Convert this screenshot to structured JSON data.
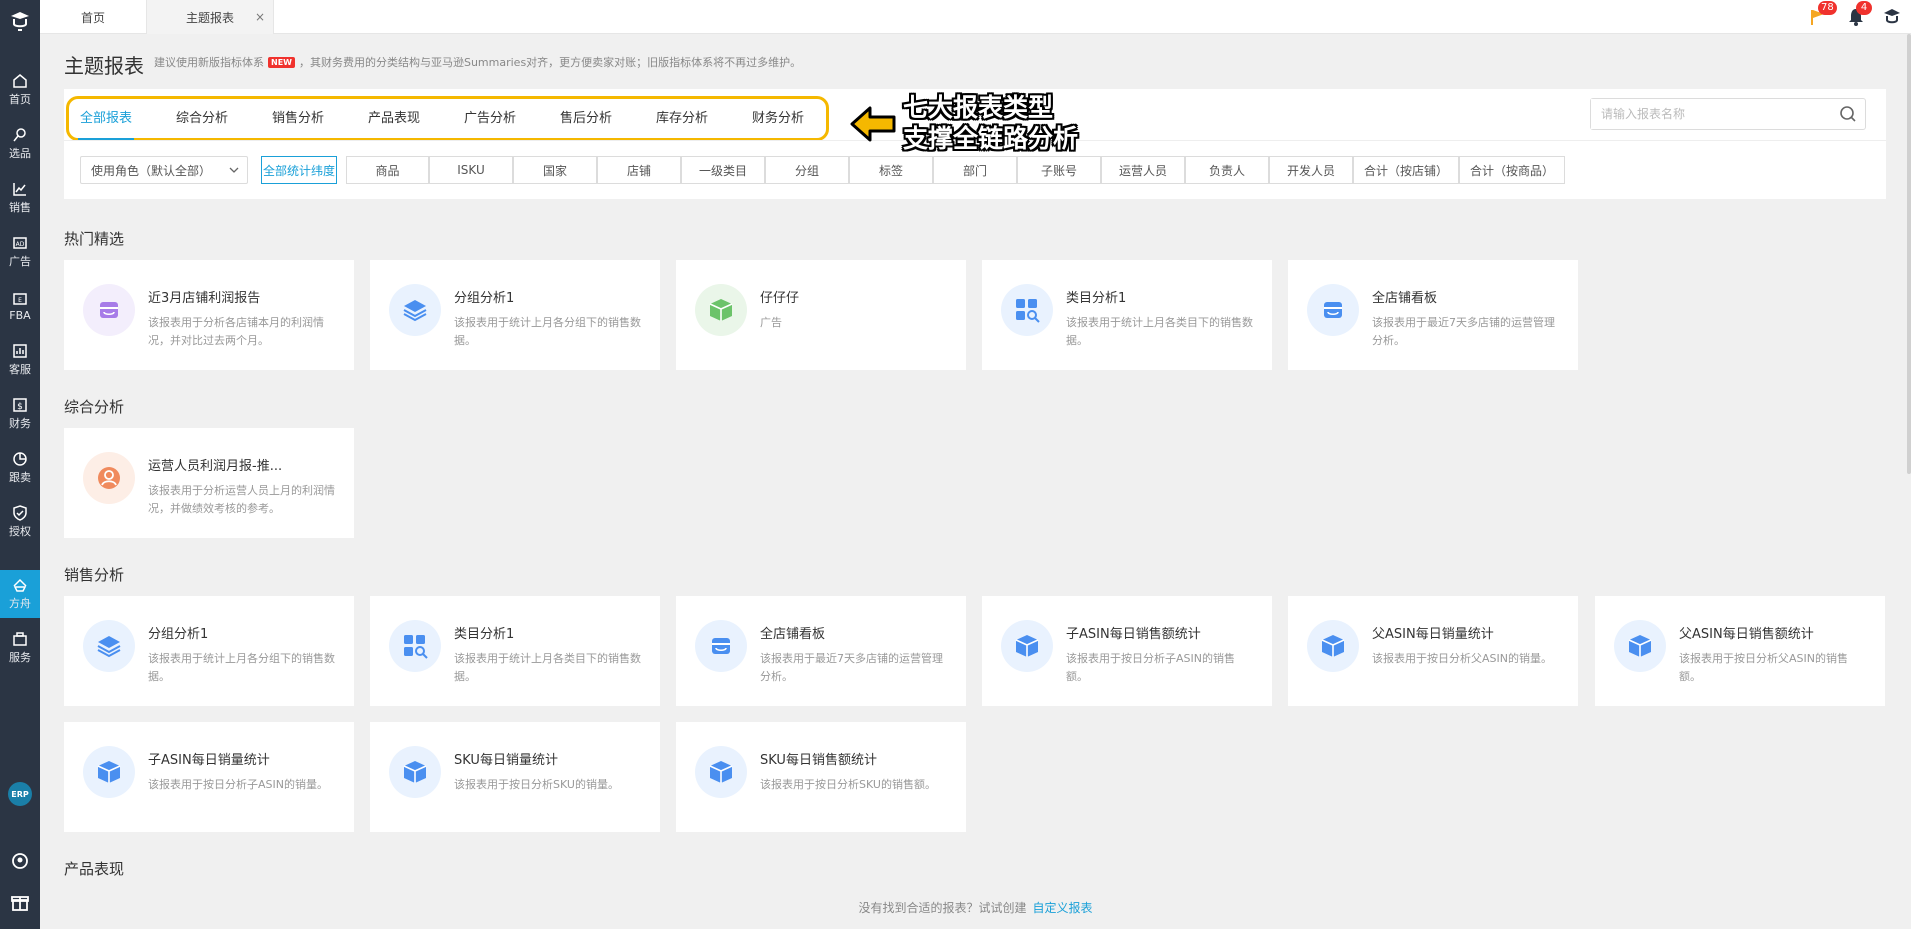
{
  "sidebar": {
    "items": [
      {
        "label": "首页",
        "icon": "home-icon"
      },
      {
        "label": "选品",
        "icon": "search-icon"
      },
      {
        "label": "销售",
        "icon": "chart-icon"
      },
      {
        "label": "广告",
        "icon": "ad-icon"
      },
      {
        "label": "FBA",
        "icon": "fba-icon"
      },
      {
        "label": "客服",
        "icon": "service-icon"
      },
      {
        "label": "财务",
        "icon": "finance-icon"
      },
      {
        "label": "跟卖",
        "icon": "pie-icon"
      },
      {
        "label": "授权",
        "icon": "shield-icon"
      },
      {
        "label": "方舟",
        "icon": "ark-icon"
      },
      {
        "label": "服务",
        "icon": "building-icon"
      }
    ],
    "active": "方舟",
    "erp_label": "ERP"
  },
  "topbar": {
    "tabs": [
      {
        "label": "首页"
      },
      {
        "label": "主题报表"
      }
    ],
    "close_symbol": "×",
    "flag_count": "78",
    "bell_count": "4"
  },
  "header": {
    "title": "主题报表",
    "note_before": "建议使用新版指标体系",
    "new_badge": "NEW",
    "note_after": "，其财务费用的分类结构与亚马逊Summaries对齐，更方便卖家对账；旧版指标体系将不再过多维护。"
  },
  "categories": [
    "全部报表",
    "综合分析",
    "销售分析",
    "产品表现",
    "广告分析",
    "售后分析",
    "库存分析",
    "财务分析"
  ],
  "annotation": {
    "line1": "七大报表类型",
    "line2": "支撑全链路分析"
  },
  "search": {
    "placeholder": "请输入报表名称"
  },
  "role_select": {
    "value": "使用角色（默认全部）"
  },
  "dimensions": [
    "全部统计纬度",
    "商品",
    "ISKU",
    "国家",
    "店铺",
    "一级类目",
    "分组",
    "标签",
    "部门",
    "子账号",
    "运营人员",
    "负责人",
    "开发人员",
    "合计（按店铺）",
    "合计（按商品）"
  ],
  "colors": {
    "accent": "#1aa0d8",
    "sidebar": "#2b3544",
    "highlight": "#f5b800",
    "badge": "#f0322d"
  },
  "sections": {
    "hot": {
      "title": "热门精选",
      "cards": [
        {
          "title": "近3月店铺利润报告",
          "desc": "该报表用于分析各店铺本月的利润情况，并对比过去两个月。",
          "icon": "store-icon"
        },
        {
          "title": "分组分析1",
          "desc": "该报表用于统计上月各分组下的销售数据。",
          "icon": "layers-icon"
        },
        {
          "title": "仔仔仔",
          "desc": "广告",
          "icon": "box-icon"
        },
        {
          "title": "类目分析1",
          "desc": "该报表用于统计上月各类目下的销售数据。",
          "icon": "grid-search-icon"
        },
        {
          "title": "全店铺看板",
          "desc": "该报表用于最近7天多店铺的运营管理分析。",
          "icon": "store-icon"
        }
      ]
    },
    "general": {
      "title": "综合分析",
      "cards": [
        {
          "title": "运营人员利润月报-推...",
          "desc": "该报表用于分析运营人员上月的利润情况，并做绩效考核的参考。",
          "icon": "person-icon"
        }
      ]
    },
    "sales": {
      "title": "销售分析",
      "cards": [
        {
          "title": "分组分析1",
          "desc": "该报表用于统计上月各分组下的销售数据。",
          "icon": "layers-icon"
        },
        {
          "title": "类目分析1",
          "desc": "该报表用于统计上月各类目下的销售数据。",
          "icon": "grid-search-icon"
        },
        {
          "title": "全店铺看板",
          "desc": "该报表用于最近7天多店铺的运营管理分析。",
          "icon": "store-icon"
        },
        {
          "title": "子ASIN每日销售额统计",
          "desc": "该报表用于按日分析子ASIN的销售额。",
          "icon": "box-icon"
        },
        {
          "title": "父ASIN每日销量统计",
          "desc": "该报表用于按日分析父ASIN的销量。",
          "icon": "box-icon"
        },
        {
          "title": "父ASIN每日销售额统计",
          "desc": "该报表用于按日分析父ASIN的销售额。",
          "icon": "box-icon"
        },
        {
          "title": "子ASIN每日销量统计",
          "desc": "该报表用于按日分析子ASIN的销量。",
          "icon": "box-icon"
        },
        {
          "title": "SKU每日销量统计",
          "desc": "该报表用于按日分析SKU的销量。",
          "icon": "box-icon"
        },
        {
          "title": "SKU每日销售额统计",
          "desc": "该报表用于按日分析SKU的销售额。",
          "icon": "box-icon"
        }
      ]
    },
    "product": {
      "title": "产品表现"
    }
  },
  "footer": {
    "text": "没有找到合适的报表？试试创建",
    "link": "自定义报表"
  }
}
